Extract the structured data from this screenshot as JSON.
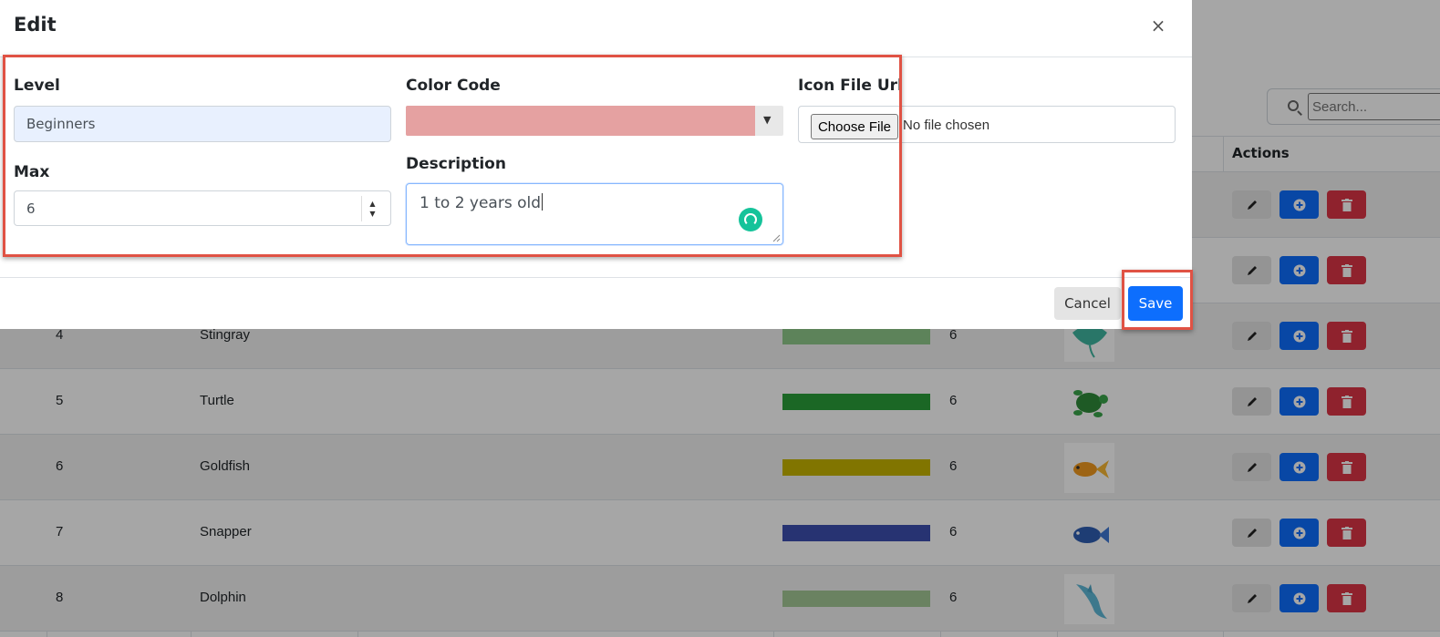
{
  "modal": {
    "title": "Edit",
    "close_glyph": "×",
    "level_label": "Level",
    "level_value": "Beginners",
    "max_label": "Max",
    "max_value": "6",
    "color_label": "Color Code",
    "color_value_hex": "#e5a1a1",
    "description_label": "Description",
    "description_value": "1 to 2 years old",
    "icon_label": "Icon File Url",
    "choose_file_label": "Choose File",
    "file_status": "No file chosen",
    "cancel_label": "Cancel",
    "save_label": "Save"
  },
  "search": {
    "placeholder": "Search..."
  },
  "table": {
    "actions_header": "Actions",
    "rows": [
      {
        "id": "4",
        "name": "Stingray",
        "color": "#8fc98a",
        "max": "6",
        "icon": "stingray-icon"
      },
      {
        "id": "5",
        "name": "Turtle",
        "color": "#2a9e3a",
        "max": "6",
        "icon": "turtle-icon"
      },
      {
        "id": "6",
        "name": "Goldfish",
        "color": "#c6b400",
        "max": "6",
        "icon": "goldfish-icon"
      },
      {
        "id": "7",
        "name": "Snapper",
        "color": "#3d4fb0",
        "max": "6",
        "icon": "snapper-icon"
      },
      {
        "id": "8",
        "name": "Dolphin",
        "color": "#a3c896",
        "max": "6",
        "icon": "dolphin-icon"
      }
    ]
  },
  "colors": {
    "primary": "#0d6efd",
    "danger": "#dc3545",
    "highlight": "#e05244",
    "grammarly": "#15c39a"
  }
}
